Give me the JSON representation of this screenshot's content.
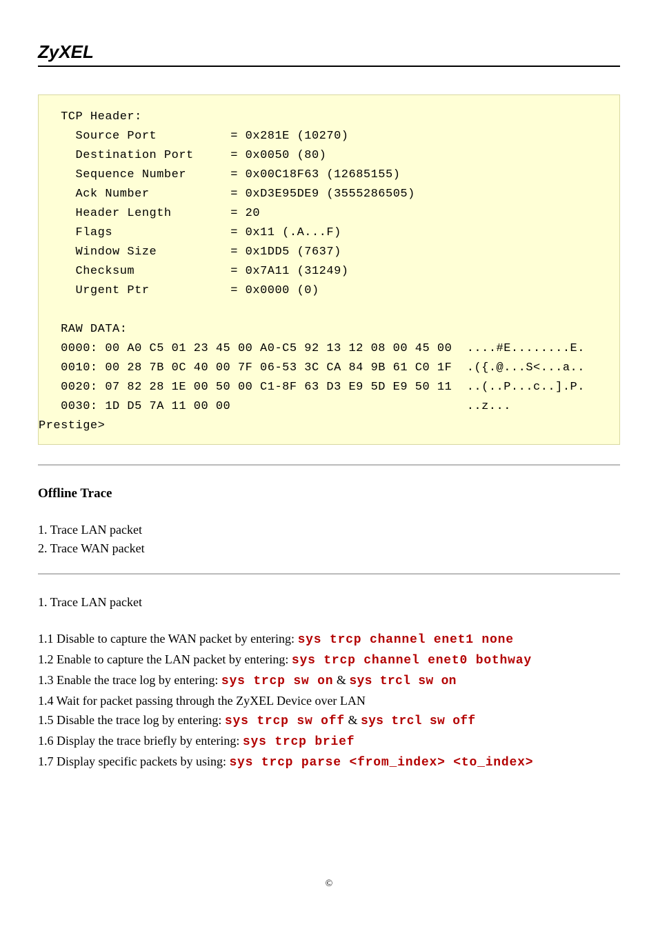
{
  "brand": "ZyXEL",
  "tcp_header": {
    "title": "TCP Header:",
    "rows": [
      {
        "label": "Source Port",
        "value": "= 0x281E (10270)"
      },
      {
        "label": "Destination Port",
        "value": "= 0x0050 (80)"
      },
      {
        "label": "Sequence Number",
        "value": "= 0x00C18F63 (12685155)"
      },
      {
        "label": "Ack Number",
        "value": "= 0xD3E95DE9 (3555286505)"
      },
      {
        "label": "Header Length",
        "value": "= 20"
      },
      {
        "label": "Flags",
        "value": "= 0x11 (.A...F)"
      },
      {
        "label": "Window Size",
        "value": "= 0x1DD5 (7637)"
      },
      {
        "label": "Checksum",
        "value": "= 0x7A11 (31249)"
      },
      {
        "label": "Urgent Ptr",
        "value": "= 0x0000 (0)"
      }
    ]
  },
  "raw_data": {
    "title": "RAW DATA:",
    "lines": [
      {
        "hex": "0000: 00 A0 C5 01 23 45 00 A0-C5 92 13 12 08 00 45 00",
        "ascii": "....#E........E."
      },
      {
        "hex": "0010: 00 28 7B 0C 40 00 7F 06-53 3C CA 84 9B 61 C0 1F",
        "ascii": ".({.@...S<...a.."
      },
      {
        "hex": "0020: 07 82 28 1E 00 50 00 C1-8F 63 D3 E9 5D E9 50 11",
        "ascii": "..(..P...c..].P."
      },
      {
        "hex": "0030: 1D D5 7A 11 00 00",
        "ascii": "..z..."
      }
    ],
    "prompt": "Prestige>"
  },
  "offline": {
    "heading": "Offline Trace",
    "items": [
      "1. Trace LAN packet",
      "2. Trace WAN packet"
    ]
  },
  "section": {
    "subhead": "1. Trace LAN packet",
    "steps": [
      {
        "pre": "1.1 Disable to capture the WAN packet by entering: ",
        "cmd1": "sys trcp channel enet1 none",
        "amp": "",
        "cmd2": ""
      },
      {
        "pre": "1.2 Enable to capture the LAN packet by entering: ",
        "cmd1": "sys trcp channel enet0 bothway",
        "amp": "",
        "cmd2": ""
      },
      {
        "pre": "1.3 Enable the trace log by entering: ",
        "cmd1": "sys trcp sw on",
        "amp": " & ",
        "cmd2": "sys trcl sw on"
      },
      {
        "pre": "1.4 Wait for packet passing through the ZyXEL Device over LAN",
        "cmd1": "",
        "amp": "",
        "cmd2": ""
      },
      {
        "pre": "1.5 Disable the trace log by entering: ",
        "cmd1": "sys trcp sw off",
        "amp": " & ",
        "cmd2": "sys trcl sw off"
      },
      {
        "pre": "1.6 Display the trace briefly by entering: ",
        "cmd1": "sys trcp brief",
        "amp": "",
        "cmd2": ""
      },
      {
        "pre": "1.7 Display specific packets by using: ",
        "cmd1": "sys trcp parse <from_index> <to_index>",
        "amp": "",
        "cmd2": ""
      }
    ]
  },
  "footer": "©"
}
